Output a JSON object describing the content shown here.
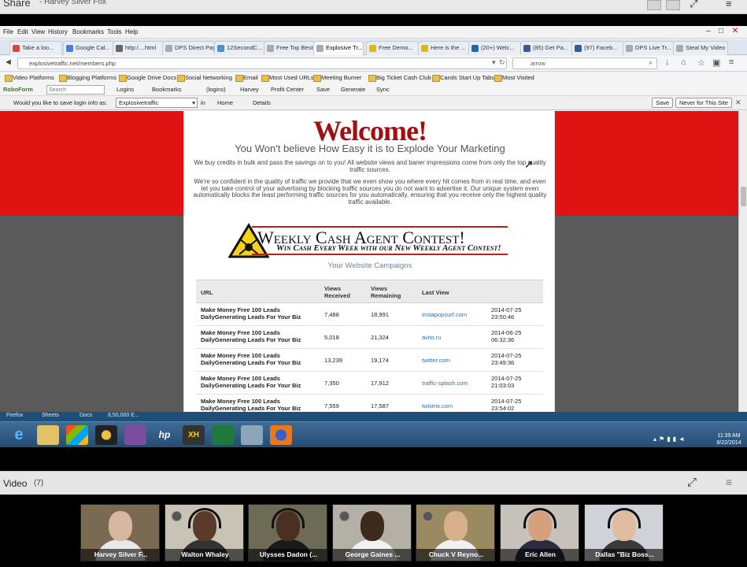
{
  "share": {
    "title": "Share",
    "subtitle": "- Harvey Silver Fox"
  },
  "browser": {
    "menu": [
      "File",
      "Edit",
      "View",
      "History",
      "Bookmarks",
      "Tools",
      "Help"
    ],
    "tabs": [
      {
        "label": "Take a loo...",
        "color": "#d44"
      },
      {
        "label": "Google Cal...",
        "color": "#4a7fd4"
      },
      {
        "label": "http:/....html",
        "color": "#666"
      },
      {
        "label": "DPS Direct Pay ...",
        "color": "#aaa"
      },
      {
        "label": "12SecondC...",
        "color": "#4a90d9"
      },
      {
        "label": "Free Top Best P...",
        "color": "#aaa"
      },
      {
        "label": "Explosive Tr...",
        "color": "#aaa",
        "active": true
      },
      {
        "label": "Free Demo...",
        "color": "#e6b800"
      },
      {
        "label": "Here is the ...",
        "color": "#e6b800"
      },
      {
        "label": "(20+) Welc...",
        "color": "#1a68b8"
      },
      {
        "label": "(85) Get Pa...",
        "color": "#3b5998"
      },
      {
        "label": "(97) Faceb...",
        "color": "#3b5998"
      },
      {
        "label": "DPS Live Tr...",
        "color": "#aaa"
      },
      {
        "label": "Steal My Video ...",
        "color": "#aaa"
      }
    ],
    "url": "explosivetraffic.net/members.php",
    "search": "arrow",
    "bookmarks": [
      "Video Platforms",
      "Blogging Platforms",
      "Google Drive Docs",
      "Social Networking",
      "Email",
      "Most Used URLs",
      "Meeting Burner",
      "Big Ticket Cash Club",
      "Carols Start Up Tabs",
      "Most Visited"
    ],
    "robo": {
      "brand": "RoboForm",
      "search_placeholder": "Search",
      "items": [
        "Logins",
        "Bookmarks",
        "(logins)",
        "Harvey",
        "Profit Center",
        "Save",
        "Generate",
        "Sync"
      ]
    },
    "savebar": {
      "prompt": "Would you like to save login info as:",
      "value": "Explosivetraffic",
      "in": "in",
      "folder": "Home",
      "details": "Details",
      "save": "Save",
      "never": "Never for This Site"
    }
  },
  "page": {
    "welcome": "Welcome!",
    "subhead": "You Won't believe How Easy it is to Explode Your Marketing",
    "para1": "We buy credits in bulk and pass the savings on to you! All website views and baner impressions come from only the top quality traffic sources.",
    "para2": "We're so confident in the quality of traffic we provide that we even show you where every hit comes from in real time, and even let you take control of your advertising by blocking traffic sources you do not want to advertise it. Our unique system even automatically blocks the least performing traffic sources for you automatically, ensuring that you receive only the highest quality traffic available.",
    "contest_title": "Weekly Cash Agent Contest!",
    "contest_sub": "Win Cash Every Week with our New Weekly Agent Contest!",
    "campaigns_label": "Your Website Campaigns",
    "table": {
      "headers": [
        "URL",
        "Views Received",
        "Views Remaining",
        "Last View"
      ],
      "rows": [
        {
          "url": "Make Money Free 100 Leads DailyGenerating Leads For Your Biz",
          "received": "7,488",
          "remaining": "18,991",
          "source": "instapopsurf.com",
          "date": "2014-07-25",
          "time": "23:50:46"
        },
        {
          "url": "Make Money Free 100 Leads DailyGenerating Leads For Your Biz",
          "received": "5,018",
          "remaining": "21,324",
          "source": "avito.ru",
          "date": "2014-06-25",
          "time": "06:32:36"
        },
        {
          "url": "Make Money Free 100 Leads DailyGenerating Leads For Your Biz",
          "received": "13,239",
          "remaining": "19,174",
          "source": "twitter.com",
          "date": "2014-07-25",
          "time": "23:49:36"
        },
        {
          "url": "Make Money Free 100 Leads DailyGenerating Leads For Your Biz",
          "received": "7,350",
          "remaining": "17,912",
          "source": "traffic-splash.com",
          "date": "2014-07-25",
          "time": "21:03:03"
        },
        {
          "url": "Make Money Free 100 Leads DailyGenerating Leads For Your Biz",
          "received": "7,559",
          "remaining": "17,587",
          "source": "twistrix.com",
          "date": "2014-07-25",
          "time": "23:54:02"
        }
      ]
    }
  },
  "taskbar": {
    "sheet_labels": [
      "Firefox",
      "Sheets",
      "Docs",
      "8,50,000 E..."
    ],
    "time": "11:39 AM",
    "date": "8/22/2014"
  },
  "video": {
    "title": "Video",
    "count": "(7)",
    "participants": [
      {
        "name": "Harvey Silver F...",
        "bg": "#7a6a52",
        "skin": "#d8b7a0",
        "shirt": "#e8e8e8"
      },
      {
        "name": "Walton Whaley",
        "bg": "#c9c3b6",
        "skin": "#5a3b2a",
        "shirt": "#333"
      },
      {
        "name": "Ulysses Dadon (...",
        "bg": "#6d6a55",
        "skin": "#4a3020",
        "shirt": "#1a1a1a"
      },
      {
        "name": "George Gaines ...",
        "bg": "#b4b0a6",
        "skin": "#3d2a1d",
        "shirt": "#f2f2f2"
      },
      {
        "name": "Chuck V Reyno...",
        "bg": "#9a8a62",
        "skin": "#d9b08c",
        "shirt": "#f0f0f0"
      },
      {
        "name": "Eric Allen",
        "bg": "#c6c2bb",
        "skin": "#d4a07e",
        "shirt": "#2c2c40"
      },
      {
        "name": "Dallas \"Biz Boss...",
        "bg": "#cfd3d8",
        "skin": "#e0bba0",
        "shirt": "#3a3a3a"
      }
    ]
  }
}
